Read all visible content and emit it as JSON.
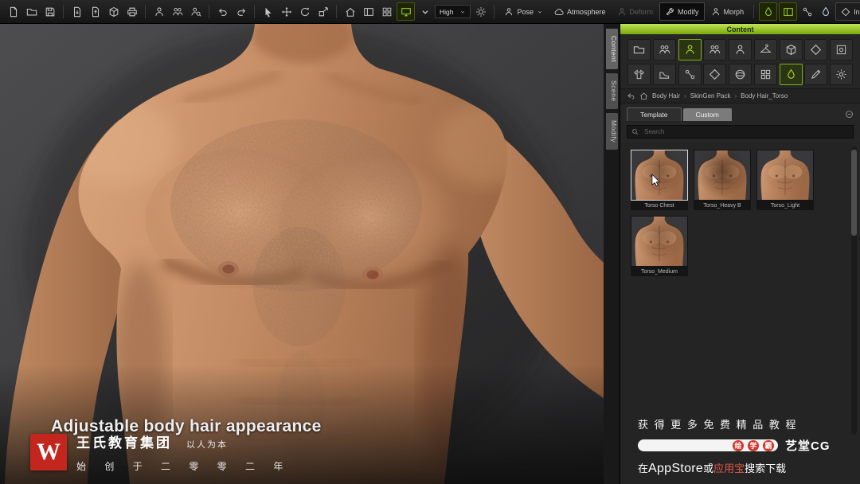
{
  "toolbar": {
    "quality_label": "High",
    "pose_label": "Pose",
    "atmosphere_label": "Atmosphere",
    "deform_label": "Deform",
    "modify_label": "Modify",
    "morph_label": "Morph",
    "installod_label": "InstaLOD"
  },
  "viewport": {
    "caption": "Adjustable body hair appearance"
  },
  "side_tabs": {
    "content": "Content",
    "scene": "Scene",
    "modify": "Modify"
  },
  "panel": {
    "title": "Content",
    "breadcrumb": {
      "items": [
        "Body Hair",
        "SkinGen Pack",
        "Body Hair_Torso"
      ],
      "sep": "›"
    },
    "tabs": {
      "template": "Template",
      "custom": "Custom"
    },
    "search_placeholder": "Search",
    "thumbnails": [
      {
        "label": "Torso Chest"
      },
      {
        "label": "Torso_Heavy B"
      },
      {
        "label": "Torso_Light"
      },
      {
        "label": "Torso_Medium"
      }
    ]
  },
  "branding": {
    "logo_letter": "W",
    "company": "王氏教育集团",
    "slogan": "以人为本",
    "since": "始 创 于 二 零 零 二 年"
  },
  "promo": {
    "line1": "获 得 更 多 免 费 精 品 教 程",
    "badges": [
      "绘",
      "学",
      "霸"
    ],
    "brand": "艺堂CG",
    "line3_pre": "在",
    "line3_store1": "AppStore",
    "line3_mid": "或",
    "line3_store2": "应用宝",
    "line3_post": "搜索下载"
  },
  "colors": {
    "accent_green": "#8fc31f",
    "brand_red": "#c3261c"
  }
}
